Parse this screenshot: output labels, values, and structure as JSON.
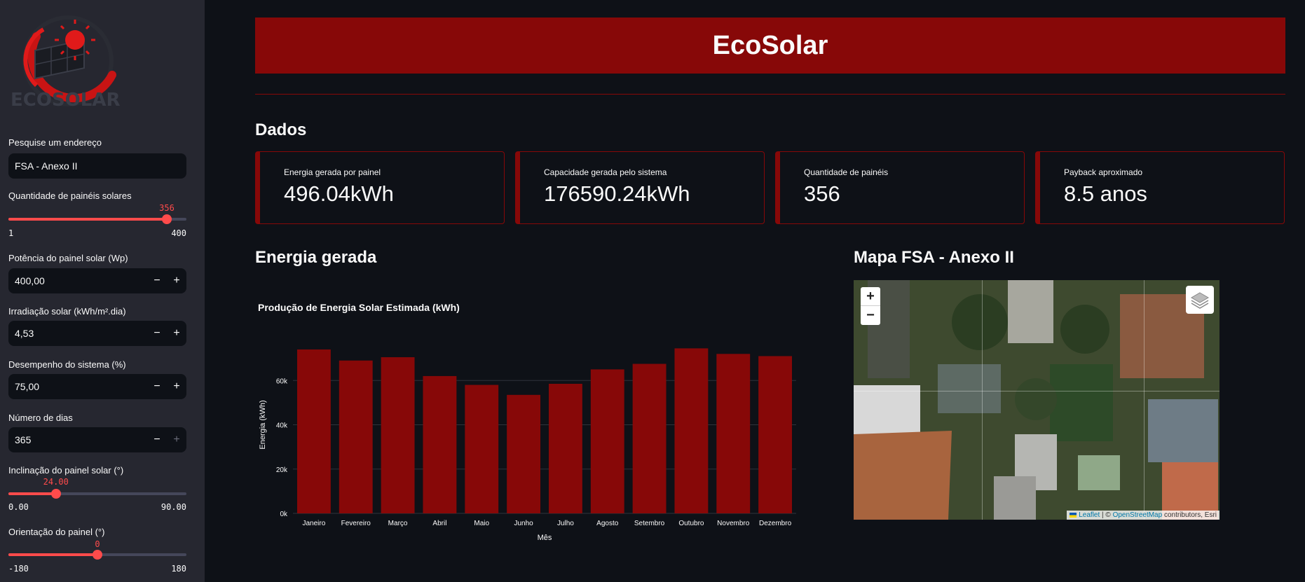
{
  "sidebar": {
    "logo_text_eco": "ECO",
    "logo_text_solar": "SOLAR",
    "address_label": "Pesquise um endereço",
    "address_value": "FSA - Anexo II",
    "panels_label": "Quantidade de painéis solares",
    "panels_value": "356",
    "panels_min": "1",
    "panels_max": "400",
    "panels_fraction": 0.8897,
    "power_label": "Potência do painel solar (Wp)",
    "power_value": "400,00",
    "irradiation_label": "Irradiação solar (kWh/m².dia)",
    "irradiation_value": "4,53",
    "performance_label": "Desempenho do sistema (%)",
    "performance_value": "75,00",
    "days_label": "Número de dias",
    "days_value": "365",
    "tilt_label": "Inclinação do painel solar (°)",
    "tilt_value": "24.00",
    "tilt_min": "0.00",
    "tilt_max": "90.00",
    "tilt_fraction": 0.2667,
    "orientation_label": "Orientação do painel (°)",
    "orientation_value": "0",
    "orientation_min": "-180",
    "orientation_max": "180",
    "orientation_fraction": 0.5,
    "minus": "−",
    "plus": "+"
  },
  "header": {
    "title": "EcoSolar"
  },
  "data_section": {
    "title": "Dados"
  },
  "metrics": [
    {
      "label": "Energia gerada por painel",
      "value": "496.04kWh"
    },
    {
      "label": "Capacidade gerada pelo sistema",
      "value": "176590.24kWh"
    },
    {
      "label": "Quantidade de painéis",
      "value": "356"
    },
    {
      "label": "Payback aproximado",
      "value": "8.5 anos"
    }
  ],
  "energy_section": {
    "title": "Energia gerada"
  },
  "map_section": {
    "title": "Mapa FSA - Anexo II",
    "zoom_in": "+",
    "zoom_out": "−",
    "attribution_leaflet": "Leaflet",
    "attribution_sep": " | © ",
    "attribution_osm": "OpenStreetMap",
    "attribution_rest": " contributors, Esri"
  },
  "colors": {
    "accent": "#870808",
    "bar": "#870808",
    "slider": "#ff4b4b",
    "background": "#0e1117",
    "sidebar": "#262730"
  },
  "chart_data": {
    "type": "bar",
    "title": "Produção de Energia Solar Estimada (kWh)",
    "xlabel": "Mês",
    "ylabel": "Energia (kWh)",
    "categories": [
      "Janeiro",
      "Fevereiro",
      "Março",
      "Abril",
      "Maio",
      "Junho",
      "Julho",
      "Agosto",
      "Setembro",
      "Outubro",
      "Novembro",
      "Dezembro"
    ],
    "values": [
      74000,
      69000,
      70500,
      62000,
      58000,
      53500,
      58500,
      65000,
      67500,
      74500,
      72000,
      71000
    ],
    "ylim": [
      0,
      80000
    ],
    "yticks": [
      0,
      20000,
      40000,
      60000
    ],
    "ytick_labels": [
      "0k",
      "20k",
      "40k",
      "60k"
    ],
    "grid": true
  }
}
